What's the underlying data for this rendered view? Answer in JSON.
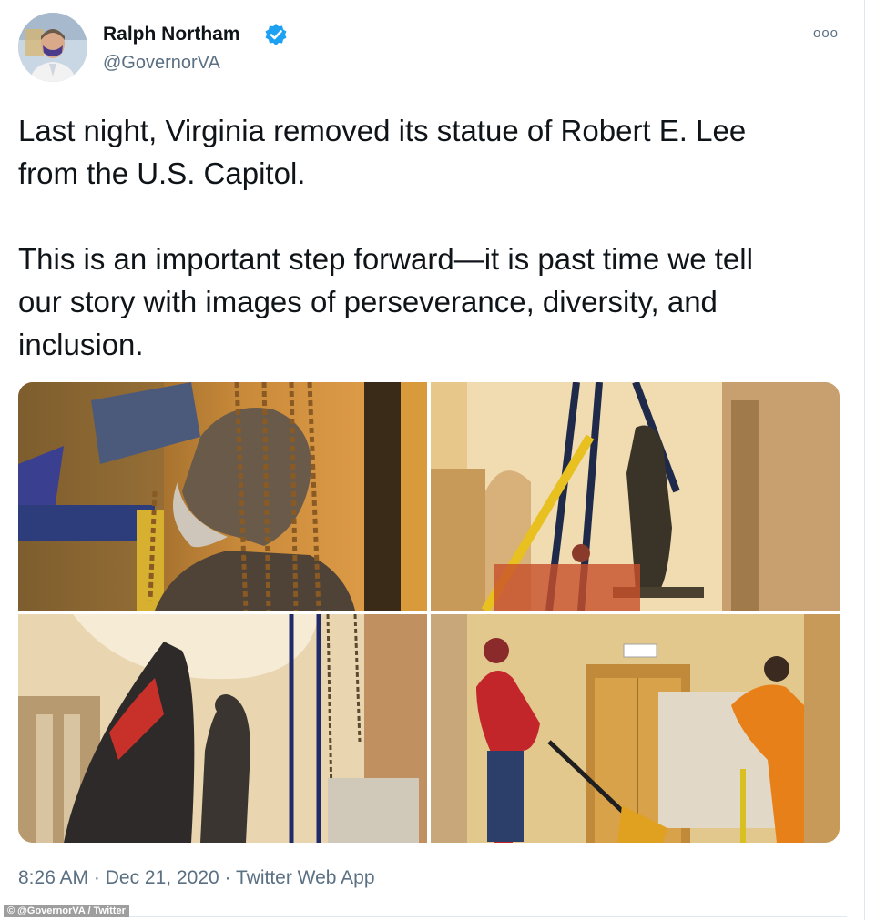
{
  "tweet": {
    "author_name": "Ralph Northam",
    "author_handle": "@GovernorVA",
    "verified_icon": "verified-badge-icon",
    "more_icon": "more-options-icon",
    "more_label": "ooo",
    "text": "Last night, Virginia removed its statue of Robert E. Lee\nfrom the U.S. Capitol.\n\nThis is an important step forward—it is past time we tell\nour story with images of perseverance, diversity, and\ninclusion.",
    "time": "8:26 AM",
    "separator": "·",
    "date": "Dec 21, 2020",
    "source": "Twitter Web App"
  },
  "credit": "© @GovernorVA / Twitter",
  "colors": {
    "accent": "#1da1f2",
    "secondary_text": "#5b7083",
    "primary_text": "#0f1419"
  }
}
